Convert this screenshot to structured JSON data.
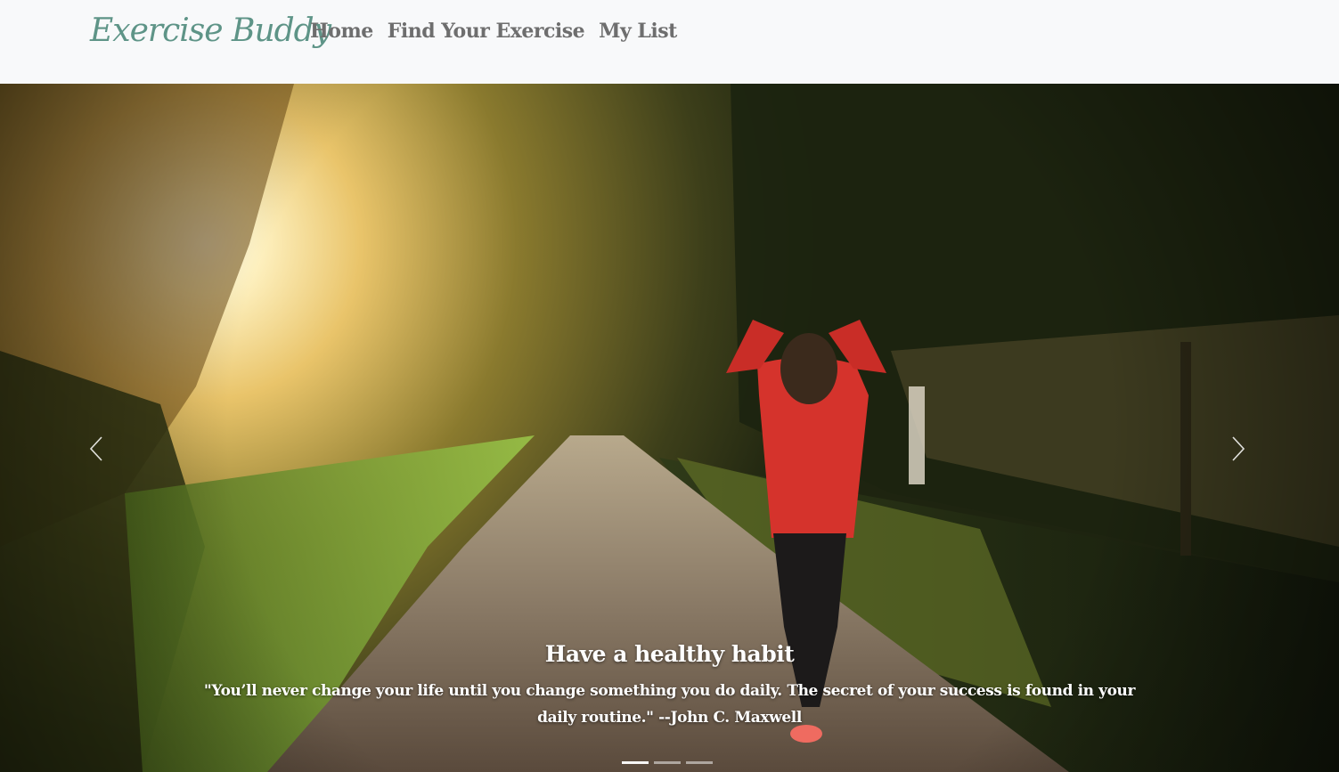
{
  "navbar": {
    "brand": "Exercise Buddy",
    "links": [
      "Home",
      "Find Your Exercise",
      "My List"
    ]
  },
  "carousel": {
    "slide": {
      "caption_title": "Have a healthy habit",
      "caption_text": "\"You’ll never change your life until you change something you do daily. The secret of your success is found in your daily routine.\" --John C. Maxwell"
    },
    "indicator_count": 3,
    "active_indicator": 0,
    "prev_icon": "chevron-left-icon",
    "next_icon": "chevron-right-icon"
  },
  "colors": {
    "brand": "#5e9487",
    "nav_link": "#6e6e6e",
    "navbar_bg": "#f8f9fa",
    "hoodie": "#d5332c"
  }
}
